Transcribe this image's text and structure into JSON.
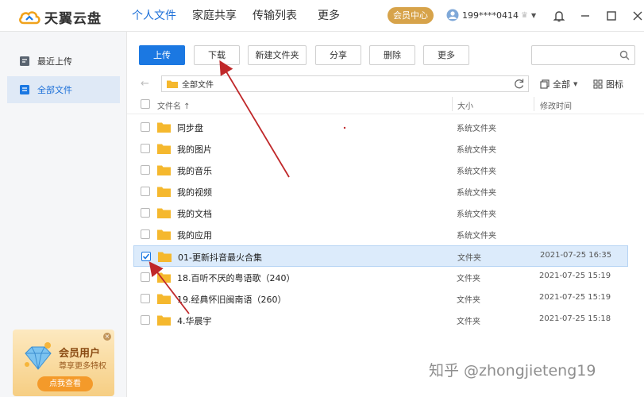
{
  "app": {
    "logo_text": "天翼云盘"
  },
  "nav": {
    "items": [
      {
        "label": "个人文件",
        "active": true
      },
      {
        "label": "家庭共享",
        "active": false
      },
      {
        "label": "传输列表",
        "active": false
      },
      {
        "label": "更多",
        "active": false
      }
    ],
    "vip_label": "会员中心",
    "username": "199****0414"
  },
  "window_controls": [
    "bell-icon",
    "minimize-icon",
    "maximize-icon",
    "close-icon"
  ],
  "sidebar": {
    "items": [
      {
        "label": "最近上传",
        "icon": "recent-upload-icon",
        "active": false
      },
      {
        "label": "全部文件",
        "icon": "all-files-icon",
        "active": true
      }
    ],
    "promo": {
      "title": "会员用户",
      "subtitle": "尊享更多特权",
      "button": "点我查看"
    }
  },
  "toolbar": {
    "buttons": [
      {
        "label": "上传",
        "primary": true
      },
      {
        "label": "下载",
        "primary": false
      },
      {
        "label": "新建文件夹",
        "primary": false
      },
      {
        "label": "分享",
        "primary": false
      },
      {
        "label": "删除",
        "primary": false
      },
      {
        "label": "更多",
        "primary": false
      }
    ],
    "search_placeholder": ""
  },
  "pathbar": {
    "path": "全部文件",
    "filter_label": "全部",
    "view_label": "图标"
  },
  "table": {
    "columns": {
      "name": "文件名 ↑",
      "size": "大小",
      "time": "修改时间"
    },
    "rows": [
      {
        "name": "同步盘",
        "size": "系统文件夹",
        "time": "",
        "checked": false
      },
      {
        "name": "我的图片",
        "size": "系统文件夹",
        "time": "",
        "checked": false
      },
      {
        "name": "我的音乐",
        "size": "系统文件夹",
        "time": "",
        "checked": false
      },
      {
        "name": "我的视频",
        "size": "系统文件夹",
        "time": "",
        "checked": false
      },
      {
        "name": "我的文档",
        "size": "系统文件夹",
        "time": "",
        "checked": false
      },
      {
        "name": "我的应用",
        "size": "系统文件夹",
        "time": "",
        "checked": false
      },
      {
        "name": "01-更新抖音最火合集",
        "size": "文件夹",
        "time": "2021-07-25 16:35",
        "checked": true
      },
      {
        "name": "18.百听不厌的粤语歌（240）",
        "size": "文件夹",
        "time": "2021-07-25 15:19",
        "checked": false
      },
      {
        "name": "19.经典怀旧闽南语（260）",
        "size": "文件夹",
        "time": "2021-07-25 15:19",
        "checked": false
      },
      {
        "name": "4.华晨宇",
        "size": "文件夹",
        "time": "2021-07-25 15:18",
        "checked": false
      }
    ]
  },
  "watermark": "知乎 @zhongjieteng19",
  "colors": {
    "accent": "#1b78e2",
    "selected_row": "#dcebfb",
    "folder": "#f5b82e",
    "vip_pill": "#d7a34a",
    "annotation_arrow": "#c0282a"
  }
}
